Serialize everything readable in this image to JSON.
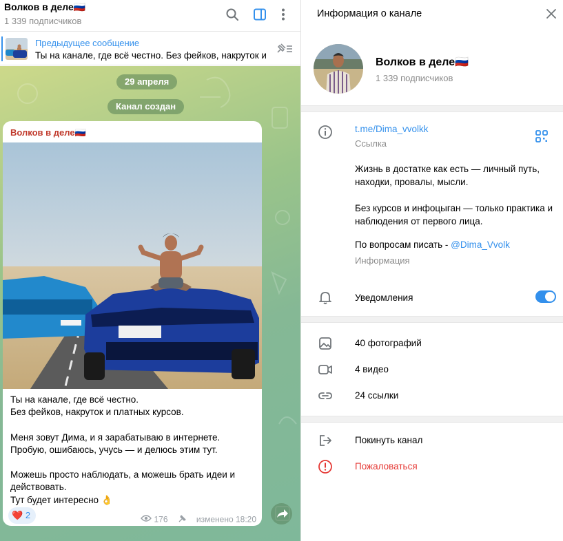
{
  "chat": {
    "title": "Волков в деле🇷🇺",
    "subscribers": "1 339 подписчиков",
    "pinned": {
      "title": "Предыдущее сообщение",
      "text": "Ты на канале, где всё честно. Без фейков, накруток и платных курсов."
    },
    "date_pill": "29 апреля",
    "service_pill": "Канал создан",
    "message": {
      "author": "Волков в деле🇷🇺",
      "text": "Ты на канале, где всё честно.\nБез фейков, накруток и платных курсов.\n\nМеня зовут Дима, и я зарабатываю в интернете.\nПробую, ошибаюсь, учусь — и делюсь этим тут.\n\nМожешь просто наблюдать, а можешь брать идеи и действовать.\nТут будет интересно 👌",
      "reaction_emoji": "❤️",
      "reaction_count": "2",
      "views": "176",
      "edited": "изменено 18:20"
    }
  },
  "info": {
    "title": "Информация о канале",
    "name": "Волков в деле🇷🇺",
    "subscribers": "1 339 подписчиков",
    "link": "t.me/Dima_vvolkk",
    "link_label": "Ссылка",
    "about": "Жизнь в достатке как есть — личный путь, находки, провалы, мысли.\n\nБез курсов и инфоцыган — только практика и наблюдения от первого лица.",
    "contact_prefix": "По вопросам писать - ",
    "contact_user": "@Dima_Vvolk",
    "about_label": "Информация",
    "notifications_label": "Уведомления",
    "notifications_on": true,
    "media": {
      "photos": "40 фотографий",
      "videos": "4 видео",
      "links": "24 ссылки"
    },
    "leave": "Покинуть канал",
    "report": "Пожаловаться"
  },
  "colors": {
    "accent": "#3390ec",
    "danger": "#e53935",
    "author": "#c0392b"
  }
}
